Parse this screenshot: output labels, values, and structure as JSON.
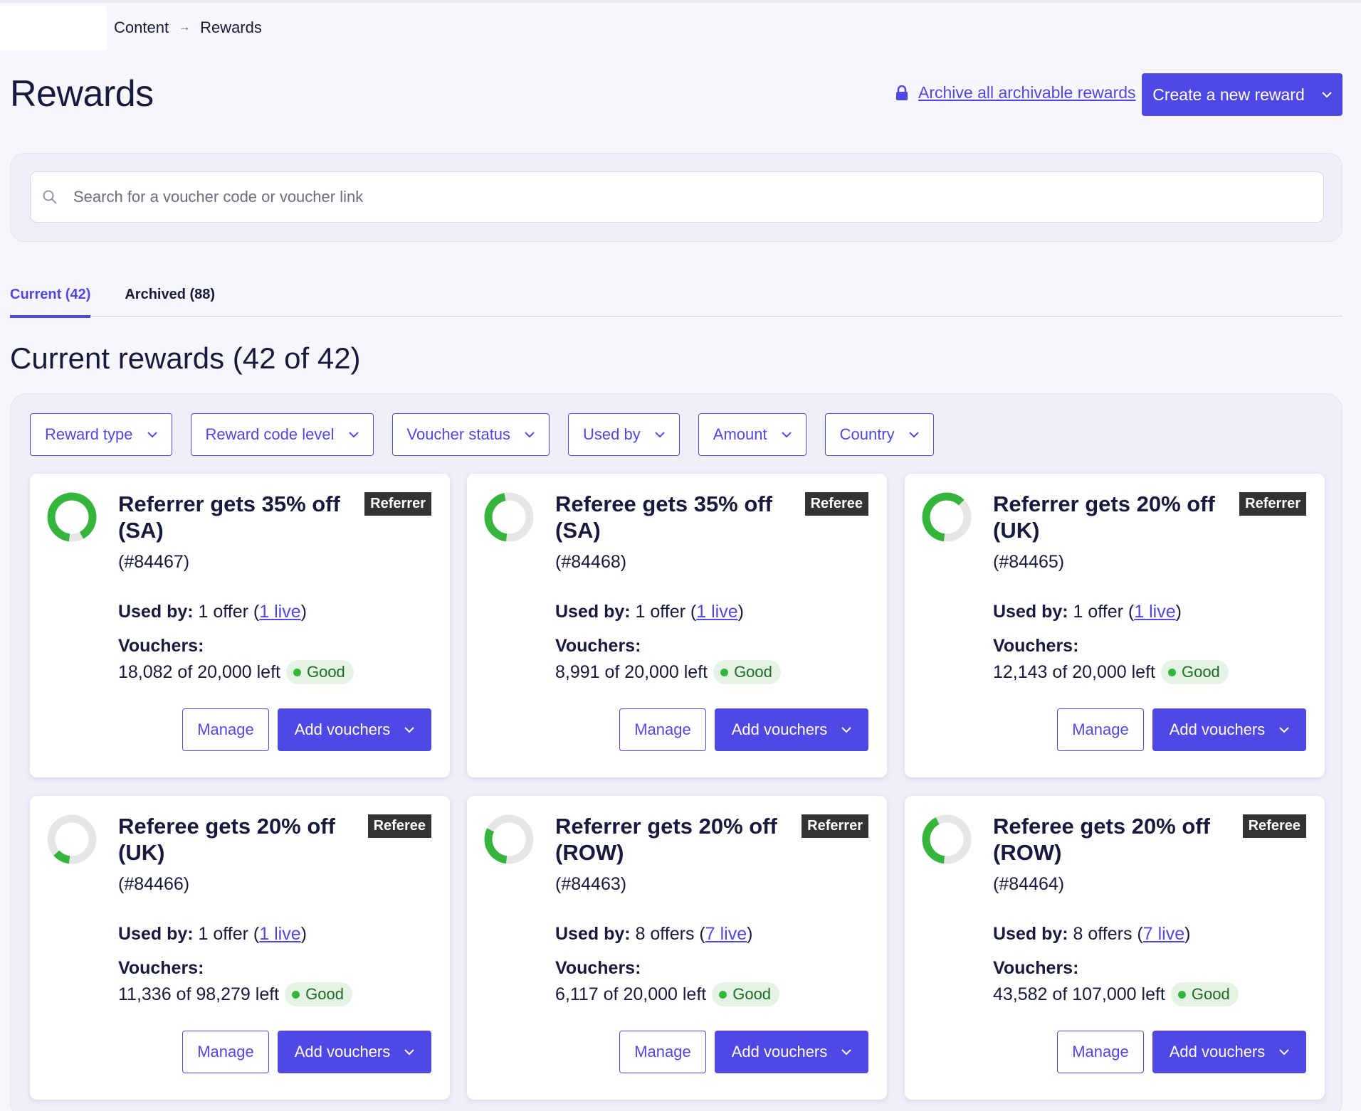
{
  "breadcrumb": {
    "items": [
      "Content",
      "Rewards"
    ]
  },
  "page": {
    "title": "Rewards",
    "archive_link": "Archive all archivable rewards",
    "create_button": "Create a new reward"
  },
  "search": {
    "placeholder": "Search for a voucher code or voucher link"
  },
  "tabs": [
    {
      "label": "Current (42)",
      "active": true
    },
    {
      "label": "Archived (88)",
      "active": false
    }
  ],
  "section_title": "Current rewards (42 of 42)",
  "filters": [
    "Reward type",
    "Reward code level",
    "Voucher status",
    "Used by",
    "Amount",
    "Country"
  ],
  "labels": {
    "used_by": "Used by:",
    "vouchers": "Vouchers:",
    "manage": "Manage",
    "add_vouchers": "Add vouchers"
  },
  "colors": {
    "accent": "#5048e5",
    "donut_fill": "#36b53c",
    "donut_track": "#e6e6e6",
    "status_good_bg": "#e4f3e4",
    "badge_bg": "#333333"
  },
  "cards": [
    {
      "title": "Referrer gets 35% off (SA)",
      "id": "(#84467)",
      "badge": "Referrer",
      "offers": "1 offer",
      "live": "1 live",
      "vouchers_left": "18,082 of 20,000 left",
      "status": "Good",
      "remaining_fraction": 0.9041
    },
    {
      "title": "Referee gets 35% off (SA)",
      "id": "(#84468)",
      "badge": "Referee",
      "offers": "1 offer",
      "live": "1 live",
      "vouchers_left": "8,991 of 20,000 left",
      "status": "Good",
      "remaining_fraction": 0.4496
    },
    {
      "title": "Referrer gets 20% off (UK)",
      "id": "(#84465)",
      "badge": "Referrer",
      "offers": "1 offer",
      "live": "1 live",
      "vouchers_left": "12,143 of 20,000 left",
      "status": "Good",
      "remaining_fraction": 0.6072
    },
    {
      "title": "Referee gets 20% off (UK)",
      "id": "(#84466)",
      "badge": "Referee",
      "offers": "1 offer",
      "live": "1 live",
      "vouchers_left": "11,336 of 98,279 left",
      "status": "Good",
      "remaining_fraction": 0.1153
    },
    {
      "title": "Referrer gets 20% off (ROW)",
      "id": "(#84463)",
      "badge": "Referrer",
      "offers": "8 offers",
      "live": "7 live",
      "vouchers_left": "6,117 of 20,000 left",
      "status": "Good",
      "remaining_fraction": 0.3059
    },
    {
      "title": "Referee gets 20% off (ROW)",
      "id": "(#84464)",
      "badge": "Referee",
      "offers": "8 offers",
      "live": "7 live",
      "vouchers_left": "43,582 of 107,000 left",
      "status": "Good",
      "remaining_fraction": 0.4073
    }
  ]
}
